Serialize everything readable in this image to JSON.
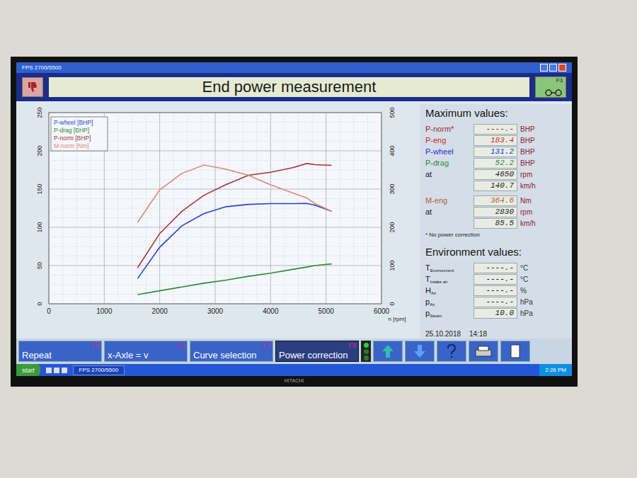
{
  "window": {
    "title": "FPS 2700/5500"
  },
  "header": {
    "title": "End power measurement",
    "right_key": "F3"
  },
  "chart": {
    "x_label": "n [rpm]",
    "x_ticks": [
      "0",
      "1000",
      "2000",
      "3000",
      "4000",
      "5000",
      "6000"
    ],
    "left_ticks": [
      "0",
      "50",
      "100",
      "150",
      "200",
      "250"
    ],
    "right_ticks": [
      "0",
      "100",
      "200",
      "300",
      "400",
      "500"
    ],
    "rpm": [
      1600,
      2000,
      2400,
      2800,
      3200,
      3600,
      4000,
      4400,
      4650,
      4800,
      5100
    ],
    "series": [
      {
        "label": "P-wheel [BHP]",
        "color": "#2b3fd6",
        "axis": "left",
        "values": [
          33,
          74,
          102,
          118,
          127,
          130,
          131,
          131,
          131.2,
          129,
          121
        ]
      },
      {
        "label": "P-drag [BHP]",
        "color": "#2f8a34",
        "axis": "left",
        "values": [
          12,
          17,
          22,
          27,
          31,
          36,
          40,
          45,
          48,
          50,
          52.2
        ]
      },
      {
        "label": "P-norm [BHP]",
        "color": "#a8323f",
        "axis": "left",
        "values": [
          47,
          92,
          121,
          142,
          156,
          168,
          172,
          178,
          183.4,
          182,
          181
        ]
      },
      {
        "label": "M-norm [Nm]",
        "color": "#dc8a72",
        "axis": "right",
        "values": [
          213,
          298,
          341,
          363,
          352,
          336,
          311,
          290,
          277,
          262,
          242
        ]
      }
    ]
  },
  "max_values": {
    "title": "Maximum values:",
    "groups": [
      [
        {
          "label": "P-norm*",
          "value": "----.-",
          "unit": "BHP",
          "color": "#9a1f33"
        },
        {
          "label": "P-eng",
          "value": "183.4",
          "unit": "BHP",
          "color": "#d21f2a"
        },
        {
          "label": "P-wheel",
          "value": "131.2",
          "unit": "BHP",
          "color": "#2233cc"
        },
        {
          "label": "P-drag",
          "value": "52.2",
          "unit": "BHP",
          "color": "#2a8a30"
        },
        {
          "label": "at",
          "value": "4650",
          "unit": "rpm",
          "color": "#1a1a1a"
        },
        {
          "label": "",
          "value": "140.7",
          "unit": "km/h",
          "color": "#1a1a1a"
        }
      ],
      [
        {
          "label": "M-eng",
          "value": "364.6",
          "unit": "Nm",
          "color": "#b0603a"
        },
        {
          "label": "at",
          "value": "2830",
          "unit": "rpm",
          "color": "#1a1a1a"
        },
        {
          "label": "",
          "value": "85.5",
          "unit": "km/h",
          "color": "#1a1a1a"
        }
      ]
    ],
    "note": "* No power correction"
  },
  "environment": {
    "title": "Environment values:",
    "rows": [
      {
        "symbol": "T",
        "sub": "Environment",
        "value": "----.-",
        "unit": "°C"
      },
      {
        "symbol": "T",
        "sub": "Intake air",
        "value": "----.-",
        "unit": "°C"
      },
      {
        "symbol": "H",
        "sub": "Air",
        "value": "----.-",
        "unit": "%"
      },
      {
        "symbol": "p",
        "sub": "Air",
        "value": "----.-",
        "unit": "hPa"
      },
      {
        "symbol": "p",
        "sub": "Steam",
        "value": "10.0",
        "unit": "hPa"
      }
    ]
  },
  "timestamp": {
    "date": "25.10.2018",
    "time": "14:18"
  },
  "buttons": [
    {
      "label": "Repeat",
      "key": "F5",
      "pressed": false
    },
    {
      "label": "x-Axle = v",
      "key": "F6",
      "pressed": false
    },
    {
      "label": "Curve selection",
      "key": "F7",
      "pressed": false
    },
    {
      "label": "Power correction",
      "key": "F8",
      "pressed": true
    }
  ],
  "taskbar": {
    "start": "start",
    "task": "FPS 2700/5500",
    "clock": "2:26 PM"
  },
  "brand": "HITACHI"
}
